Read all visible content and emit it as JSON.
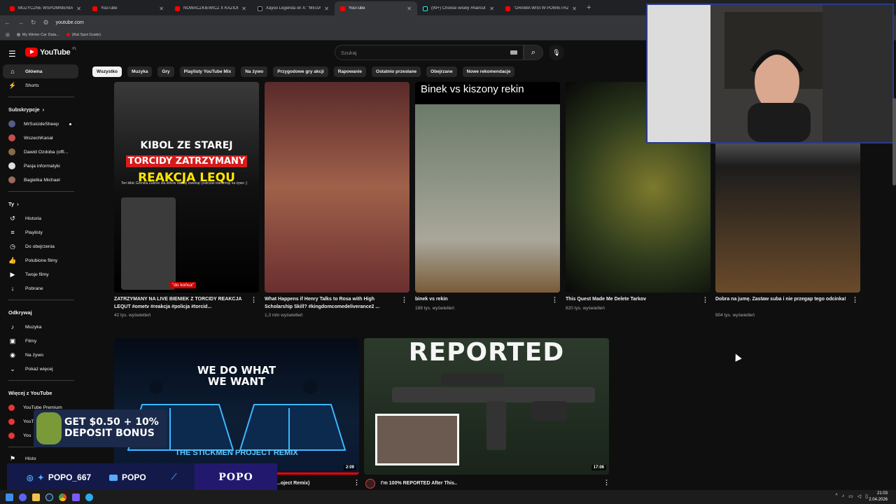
{
  "browser": {
    "tabs": [
      {
        "title": "MUZYCZNE WSPOMNIENIA KL",
        "icon": "youtube-icon",
        "active": false
      },
      {
        "title": "YouTube",
        "icon": "youtube-icon",
        "active": false
      },
      {
        "title": "NOWACZKIEWICZ X KAZIOR",
        "icon": "youtube-icon",
        "active": false
      },
      {
        "title": "Xayoo Legenda on X: \"MEGA",
        "icon": "x-icon",
        "active": false
      },
      {
        "title": "YouTube",
        "icon": "youtube-icon",
        "active": true
      },
      {
        "title": "(99+) Choose wisely #haircut #",
        "icon": "tiktok-icon",
        "active": false
      },
      {
        "title": "\"DRAMA WISI W POWIETRZU\"",
        "icon": "youtube-icon",
        "active": false
      }
    ],
    "url": "youtube.com",
    "bookmarks": [
      "My Winter Car Data...",
      "(Rat Spot Guide)"
    ]
  },
  "youtube": {
    "logo_text": "YouTube",
    "region": "PL",
    "search_placeholder": "Szukaj"
  },
  "sidebar": {
    "main": [
      {
        "label": "Główna",
        "icon": "home-icon"
      },
      {
        "label": "Shorts",
        "icon": "shorts-icon"
      }
    ],
    "subs_heading": "Subskrypcje",
    "subs": [
      {
        "label": "MrSuicideSheep",
        "color": "#5a5a8a",
        "live": true
      },
      {
        "label": "WszechKanał",
        "color": "#c94d4d",
        "live": false
      },
      {
        "label": "Dawid Ozdoba (offi...",
        "color": "#8a6a4a",
        "live": false
      },
      {
        "label": "Pasja informatyki",
        "color": "#e0e0e0",
        "live": false
      },
      {
        "label": "Bagietka Michael",
        "color": "#9a6a5a",
        "live": false
      }
    ],
    "you_heading": "Ty",
    "you": [
      {
        "label": "Historia",
        "icon": "history-icon"
      },
      {
        "label": "Playlisty",
        "icon": "playlist-icon"
      },
      {
        "label": "Do obejrzenia",
        "icon": "clock-icon"
      },
      {
        "label": "Polubione filmy",
        "icon": "like-icon"
      },
      {
        "label": "Twoje filmy",
        "icon": "video-icon"
      },
      {
        "label": "Pobrane",
        "icon": "download-icon"
      }
    ],
    "explore_heading": "Odkrywaj",
    "explore": [
      {
        "label": "Muzyka",
        "icon": "music-icon"
      },
      {
        "label": "Filmy",
        "icon": "film-icon"
      },
      {
        "label": "Na żywo",
        "icon": "live-icon"
      },
      {
        "label": "Pokaż więcej",
        "icon": "chevron-down-icon"
      }
    ],
    "more_heading": "Więcej z YouTube",
    "more": [
      {
        "label": "YouTube Premium"
      },
      {
        "label": "YouTube Music"
      },
      {
        "label": "You"
      }
    ],
    "history_partial": "Histo"
  },
  "chips": [
    "Wszystko",
    "Muzyka",
    "Gry",
    "Playlisty YouTube Mix",
    "Na żywo",
    "Przygodowe gry akcji",
    "Rapowanie",
    "Ostatnio przesłane",
    "Obejrzane",
    "Nowe rekomendacje"
  ],
  "videos_row1": [
    {
      "title": "ZATRZYMANY NA LIVE BIENIEK Z TORCIDY REAKCJA LEQUT #ometv #reakcja #policja #torcid...",
      "views": "42 tys. wyświetleń",
      "thumb_text": [
        "KIBOL ZE STAREJ",
        "TORCIDY ZATRZYMANY",
        "REAKCJA LEQU"
      ],
      "thumb_caption": "Ten kibic Górnika Zabrze dla kilków dał się zawinąć podczas transmisji na żywo ;)",
      "thumb_sub": "\"do końca\""
    },
    {
      "title": "What Happens if Henry Talks to Rosa with High Scholarship Skill? #kingdomcomedeliverance2 ...",
      "views": "1,3 mln wyświetleń"
    },
    {
      "title": "binek vs rekin",
      "views": "189 tys. wyświetleń",
      "thumb_text": "Binek vs kiszony rekin"
    },
    {
      "title": "This Quest Made Me Delete Tarkov",
      "views": "820 tys. wyświetleń"
    },
    {
      "title": "Dobra na jumę. Zastaw suba i nie przegap tego odcinka!",
      "views": "904 tys. wyświetleń"
    }
  ],
  "videos_row2": [
    {
      "title": "...oject Remix)",
      "duration": "2:09",
      "thumb_text": [
        "WE DO WHAT",
        "WE WANT"
      ],
      "thumb_footer": "THE STICKMEN PROJECT REMIX"
    },
    {
      "title": "I'm 100% REPORTED After This..",
      "duration": "17:06",
      "thumb_text": "REPORTED"
    }
  ],
  "stream_overlay": {
    "handle": "POPO_667",
    "yt_name": "POPO",
    "name": "POPO",
    "promo": [
      "GET $0.50 + 10%",
      "DEPOSIT BONUS"
    ]
  },
  "clock": {
    "time": "21:03",
    "date": "2.04.2026"
  }
}
